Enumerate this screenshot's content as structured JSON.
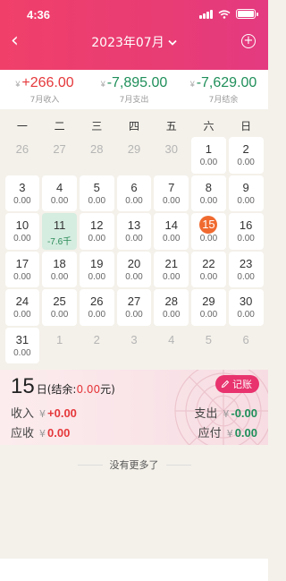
{
  "status": {
    "time": "4:36"
  },
  "nav": {
    "back_icon": "‹",
    "title": "2023年07月",
    "chevron": "⌄",
    "add_icon": "+"
  },
  "summary": [
    {
      "value": "+266.00",
      "label": "7月收入",
      "color": "#e5383b"
    },
    {
      "value": "-7,895.00",
      "label": "7月支出",
      "color": "#1f8f5a"
    },
    {
      "value": "-7,629.00",
      "label": "7月结余",
      "color": "#1f8f5a"
    }
  ],
  "currency": "¥",
  "weekdays": [
    "一",
    "二",
    "三",
    "四",
    "五",
    "六",
    "日"
  ],
  "calendar": [
    {
      "day": "26",
      "value": "",
      "muted": true
    },
    {
      "day": "27",
      "value": "",
      "muted": true
    },
    {
      "day": "28",
      "value": "",
      "muted": true
    },
    {
      "day": "29",
      "value": "",
      "muted": true
    },
    {
      "day": "30",
      "value": "",
      "muted": true
    },
    {
      "day": "1",
      "value": "0.00"
    },
    {
      "day": "2",
      "value": "0.00"
    },
    {
      "day": "3",
      "value": "0.00"
    },
    {
      "day": "4",
      "value": "0.00"
    },
    {
      "day": "5",
      "value": "0.00"
    },
    {
      "day": "6",
      "value": "0.00"
    },
    {
      "day": "7",
      "value": "0.00"
    },
    {
      "day": "8",
      "value": "0.00"
    },
    {
      "day": "9",
      "value": "0.00"
    },
    {
      "day": "10",
      "value": "0.00"
    },
    {
      "day": "11",
      "value": "-7.6千",
      "highlight": true
    },
    {
      "day": "12",
      "value": "0.00"
    },
    {
      "day": "13",
      "value": "0.00"
    },
    {
      "day": "14",
      "value": "0.00"
    },
    {
      "day": "15",
      "value": "0.00",
      "today": true
    },
    {
      "day": "16",
      "value": "0.00"
    },
    {
      "day": "17",
      "value": "0.00"
    },
    {
      "day": "18",
      "value": "0.00"
    },
    {
      "day": "19",
      "value": "0.00"
    },
    {
      "day": "20",
      "value": "0.00"
    },
    {
      "day": "21",
      "value": "0.00"
    },
    {
      "day": "22",
      "value": "0.00"
    },
    {
      "day": "23",
      "value": "0.00"
    },
    {
      "day": "24",
      "value": "0.00"
    },
    {
      "day": "25",
      "value": "0.00"
    },
    {
      "day": "26",
      "value": "0.00"
    },
    {
      "day": "27",
      "value": "0.00"
    },
    {
      "day": "28",
      "value": "0.00"
    },
    {
      "day": "29",
      "value": "0.00"
    },
    {
      "day": "30",
      "value": "0.00"
    },
    {
      "day": "31",
      "value": "0.00"
    },
    {
      "day": "1",
      "value": "",
      "muted": true
    },
    {
      "day": "2",
      "value": "",
      "muted": true
    },
    {
      "day": "3",
      "value": "",
      "muted": true
    },
    {
      "day": "4",
      "value": "",
      "muted": true
    },
    {
      "day": "5",
      "value": "",
      "muted": true
    },
    {
      "day": "6",
      "value": "",
      "muted": true
    }
  ],
  "detail": {
    "day": "15",
    "day_suffix": "日(结余:",
    "balance": "0.00",
    "balance_suffix": "元)",
    "record_label": "记账",
    "record_icon": "pencil-icon",
    "income_label": "收入",
    "income_value": "+0.00",
    "expense_label": "支出",
    "expense_value": "-0.00",
    "receivable_label": "应收",
    "receivable_value": "0.00",
    "payable_label": "应付",
    "payable_value": "0.00"
  },
  "footer_note": "没有更多了"
}
